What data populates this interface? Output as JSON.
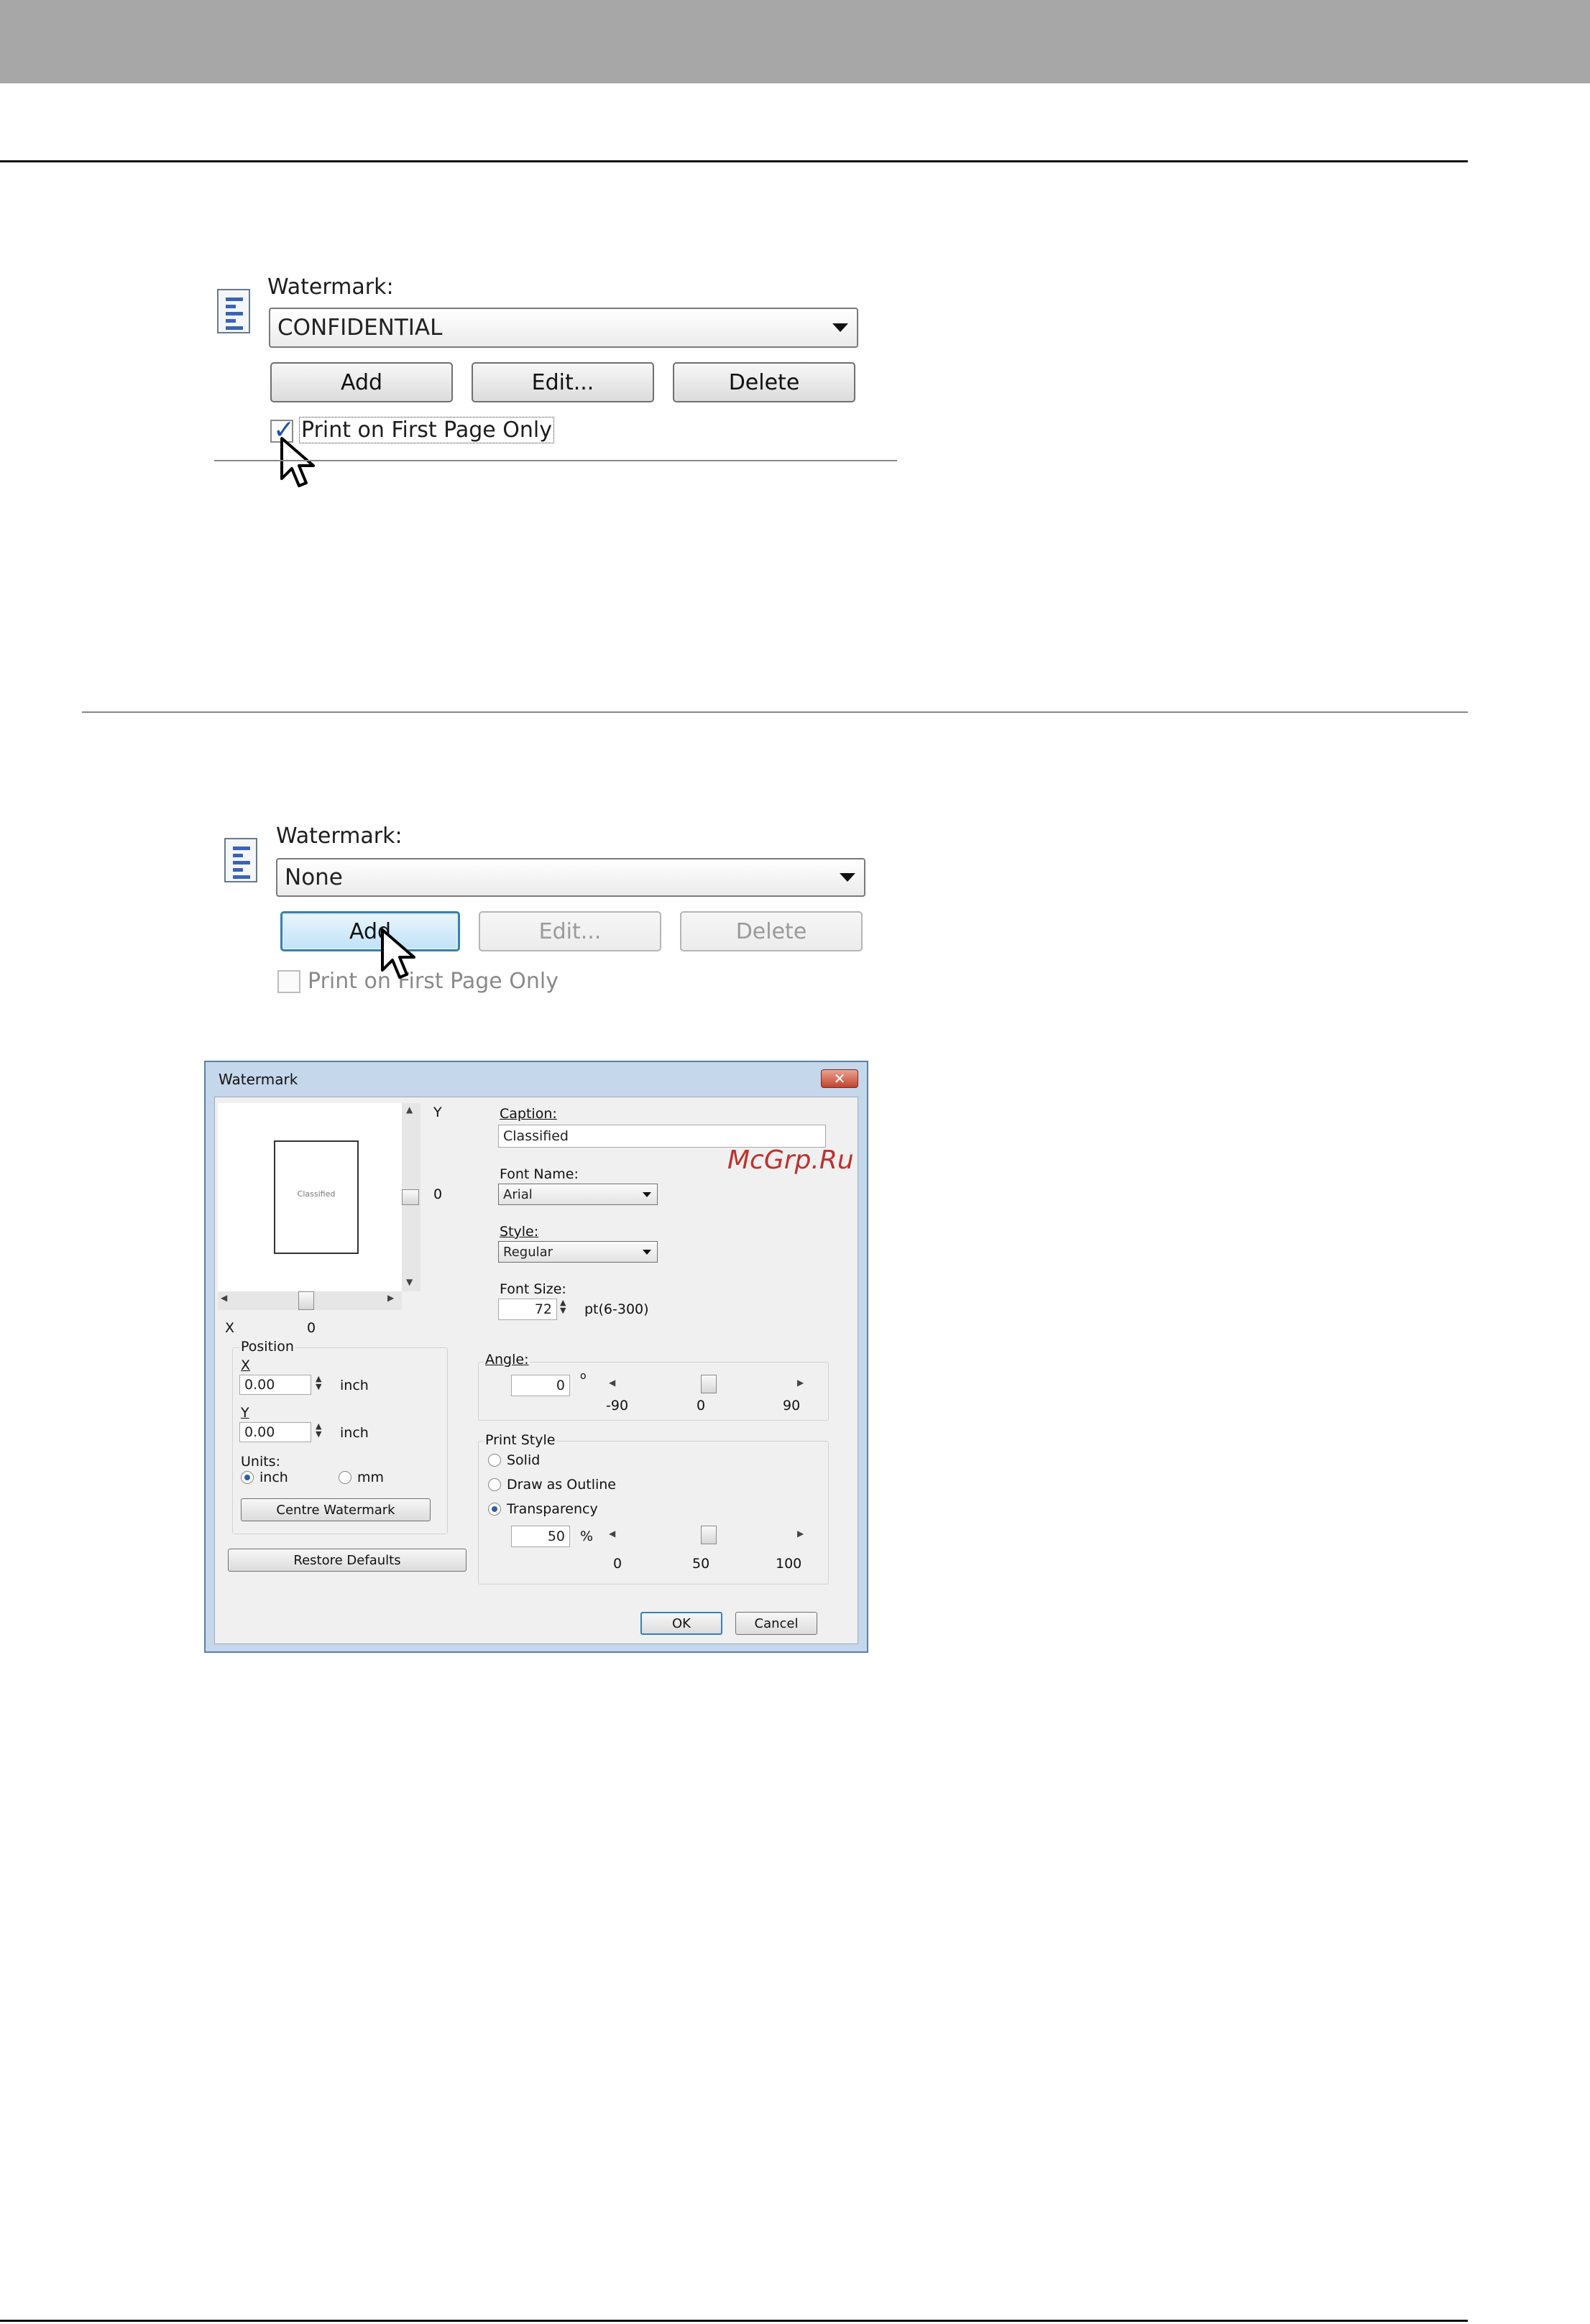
{
  "panel1": {
    "watermark_label": "Watermark:",
    "selected": "CONFIDENTIAL",
    "add_label": "Add",
    "edit_label": "Edit...",
    "delete_label": "Delete",
    "checkbox_label": "Print on First Page Only",
    "checkbox_checked": true
  },
  "panel2": {
    "watermark_label": "Watermark:",
    "selected": "None",
    "add_label": "Add",
    "edit_label": "Edit...",
    "delete_label": "Delete",
    "checkbox_label": "Print on First Page Only",
    "checkbox_checked": false
  },
  "dialog": {
    "title": "Watermark",
    "close_glyph": "✕",
    "preview_text": "Classified",
    "y_axis_label": "Y",
    "y_value": "0",
    "x_axis_label": "X",
    "x_value": "0",
    "caption_label": "Caption:",
    "caption_value": "Classified",
    "font_name_label": "Font Name:",
    "font_name_value": "Arial",
    "style_label": "Style:",
    "style_value": "Regular",
    "font_size_label": "Font Size:",
    "font_size_value": "72",
    "font_size_range": "pt(6-300)",
    "position": {
      "group_label": "Position",
      "x_label": "X",
      "x_value": "0.00",
      "x_unit": "inch",
      "y_label": "Y",
      "y_value": "0.00",
      "y_unit": "inch",
      "units_label": "Units:",
      "unit_inch": "inch",
      "unit_mm": "mm",
      "selected_unit": "inch",
      "centre_button": "Centre Watermark"
    },
    "restore_defaults": "Restore Defaults",
    "angle": {
      "label": "Angle:",
      "value": "0",
      "degree_symbol": "o",
      "min": "-90",
      "mid": "0",
      "max": "90",
      "slider_value": 0
    },
    "print_style": {
      "group_label": "Print Style",
      "solid": "Solid",
      "outline": "Draw as Outline",
      "transparency": "Transparency",
      "selected": "Transparency",
      "transparency_value": "50",
      "percent": "%",
      "min": "0",
      "mid": "50",
      "max": "100",
      "slider_value": 50
    },
    "ok": "OK",
    "cancel": "Cancel"
  },
  "site_watermark": "McGrp.Ru"
}
